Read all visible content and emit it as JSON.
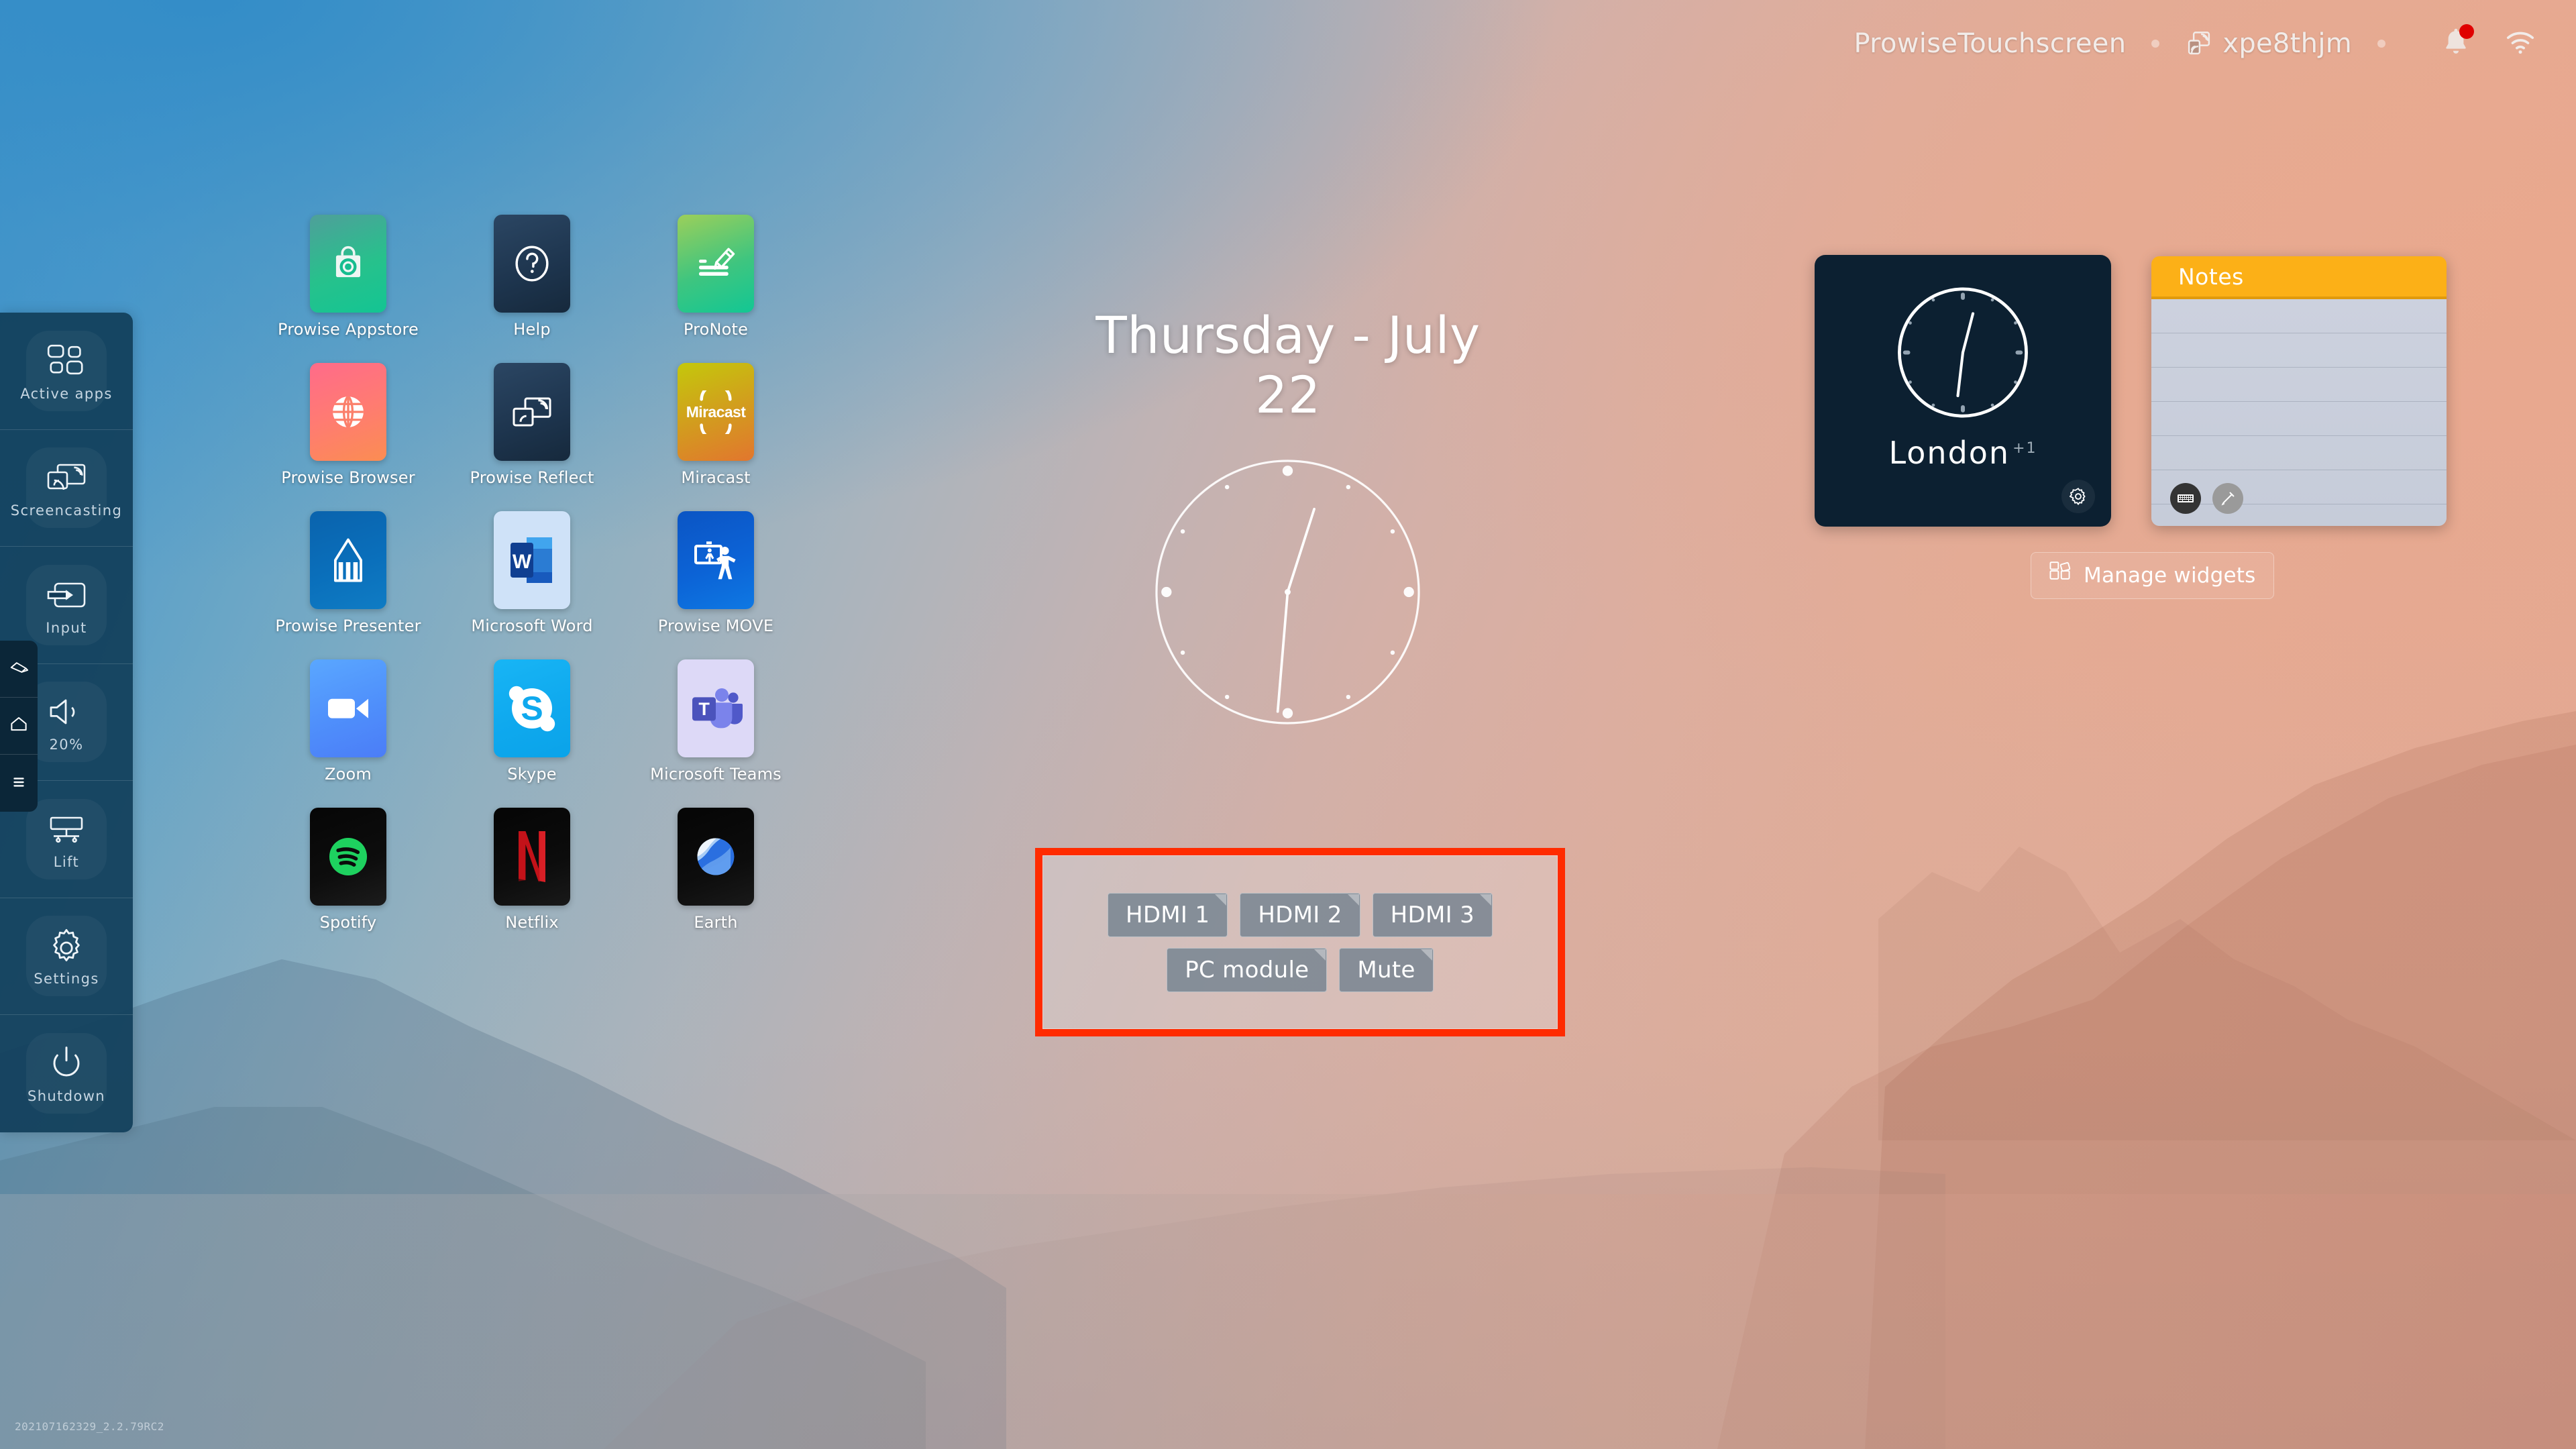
{
  "topbar": {
    "device_name": "ProwiseTouchscreen",
    "cast_icon": "screencast-icon",
    "session_code": "xpe8thjm",
    "notification_icon": "bell-icon",
    "notification_badge": true,
    "wifi_icon": "wifi-icon"
  },
  "edge_tabs": [
    {
      "name": "annotate",
      "icon": "pen-icon"
    },
    {
      "name": "home",
      "icon": "home-icon"
    },
    {
      "name": "menu",
      "icon": "hamburger-menu-icon"
    }
  ],
  "sidebar": {
    "items": [
      {
        "label": "Active apps",
        "icon": "grid-apps-icon"
      },
      {
        "label": "Screencasting",
        "icon": "screencast-icon"
      },
      {
        "label": "Input",
        "icon": "input-arrow-icon"
      },
      {
        "label": "20%",
        "icon": "volume-icon"
      },
      {
        "label": "Lift",
        "icon": "lift-icon"
      },
      {
        "label": "Settings",
        "icon": "gear-icon"
      },
      {
        "label": "Shutdown",
        "icon": "power-icon"
      }
    ]
  },
  "apps": [
    {
      "label": "Prowise Appstore",
      "icon": "shopping-bag-icon"
    },
    {
      "label": "Help",
      "icon": "question-mark-icon"
    },
    {
      "label": "ProNote",
      "icon": "pencil-note-icon"
    },
    {
      "label": "Prowise Browser",
      "icon": "globe-icon"
    },
    {
      "label": "Prowise Reflect",
      "icon": "screen-mirror-icon"
    },
    {
      "label": "Miracast",
      "icon": "miracast-icon",
      "wordmark": "Miracast"
    },
    {
      "label": "Prowise Presenter",
      "icon": "pencil-icon"
    },
    {
      "label": "Microsoft Word",
      "icon": "word-icon",
      "glyph": "W"
    },
    {
      "label": "Prowise MOVE",
      "icon": "whiteboard-person-icon"
    },
    {
      "label": "Zoom",
      "icon": "video-camera-icon"
    },
    {
      "label": "Skype",
      "icon": "skype-icon",
      "glyph": "S"
    },
    {
      "label": "Microsoft Teams",
      "icon": "teams-icon",
      "glyph": "T"
    },
    {
      "label": "Spotify",
      "icon": "spotify-icon"
    },
    {
      "label": "Netflix",
      "icon": "netflix-icon",
      "glyph": "N"
    },
    {
      "label": "Earth",
      "icon": "google-earth-icon"
    }
  ],
  "desktop": {
    "date_text": "Thursday - July 22",
    "clock_icon": "analog-clock-face"
  },
  "widgets": {
    "world_clock": {
      "city": "London",
      "extra_count": "+1",
      "settings_icon": "gear-icon"
    },
    "notes": {
      "title": "Notes",
      "keyboard_icon": "keyboard-icon",
      "pen_icon": "pencil-icon",
      "empty_lines": 6
    },
    "manage_button": {
      "label": "Manage widgets",
      "icon": "widgets-grid-icon"
    }
  },
  "input_panel": {
    "highlight_color": "#ff2b00",
    "rows": [
      [
        "HDMI 1",
        "HDMI 2",
        "HDMI 3"
      ],
      [
        "PC module",
        "Mute"
      ]
    ]
  },
  "build_version": "202107162329_2.2.79RC2"
}
